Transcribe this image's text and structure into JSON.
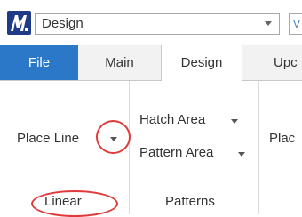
{
  "workflow": {
    "selected": "Design",
    "partial_button_glyph": "V"
  },
  "icons": {
    "app_logo": "microstation-logo-icon",
    "dropdown": "chevron-down-icon"
  },
  "tabs": [
    {
      "label": "File"
    },
    {
      "label": "Main"
    },
    {
      "label": "Design"
    },
    {
      "label": "Upc"
    }
  ],
  "ribbon": {
    "linear": {
      "place_line": "Place Line",
      "group_label": "Linear"
    },
    "patterns": {
      "hatch_area": "Hatch Area",
      "pattern_area": "Pattern Area",
      "group_label": "Patterns"
    },
    "next_group_partial": "Plac"
  },
  "colors": {
    "file_tab": "#2b78c9",
    "logo": "#1f3a86",
    "annotation": "#e03a3a"
  }
}
